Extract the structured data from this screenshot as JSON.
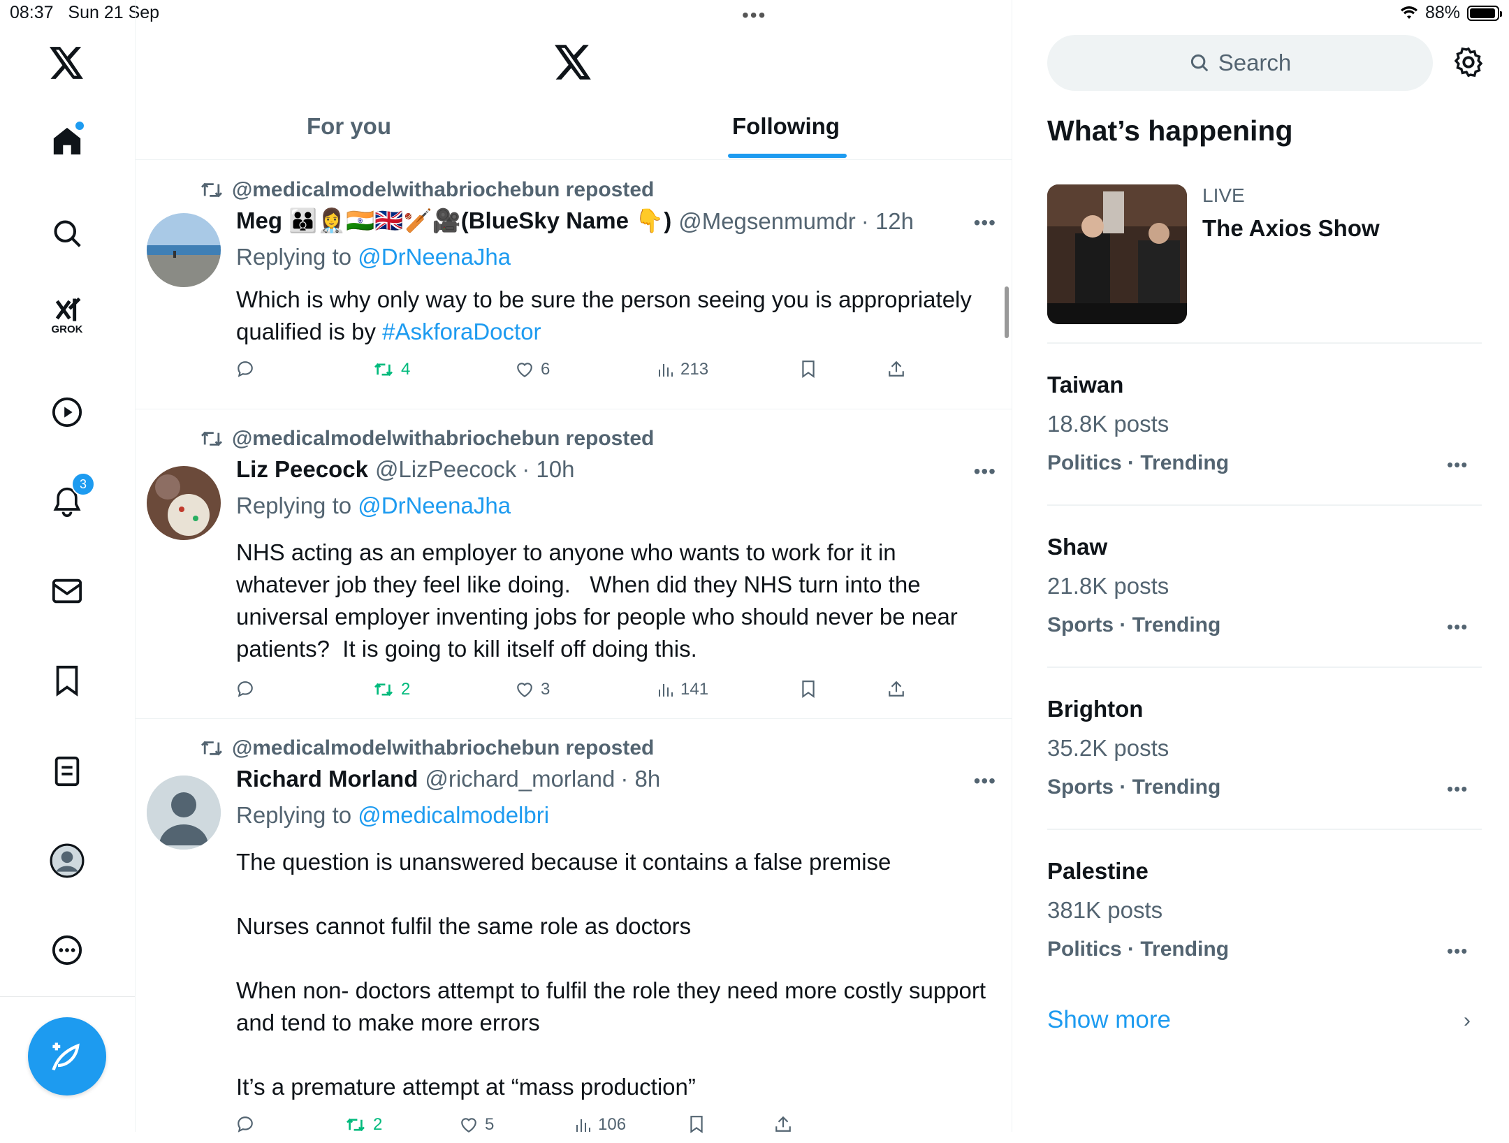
{
  "status": {
    "time": "08:37",
    "date": "Sun 21 Sep",
    "battery": "88%",
    "battery_level": 0.88
  },
  "nav": {
    "items": [
      {
        "name": "home-icon"
      },
      {
        "name": "search-icon"
      },
      {
        "name": "grok-icon",
        "label": "GROK"
      },
      {
        "name": "video-icon"
      },
      {
        "name": "notifications-icon",
        "badge": "3"
      },
      {
        "name": "messages-icon"
      },
      {
        "name": "bookmarks-icon"
      },
      {
        "name": "lists-icon"
      },
      {
        "name": "profile-icon"
      },
      {
        "name": "more-icon"
      }
    ],
    "compose_icon": "compose-icon"
  },
  "tabs": [
    {
      "label": "For you"
    },
    {
      "label": "Following"
    }
  ],
  "posts": [
    {
      "repost_by": "@medicalmodelwithabriochebun reposted",
      "name": "Meg 👪👩‍⚕️🇮🇳🇬🇧🏏🎥(BlueSky Name 👇)",
      "handle": "@Megsenmumdr",
      "time": "· 12h",
      "reply_label": "Replying to",
      "reply_to": "@DrNeenaJha",
      "text": "Which is why only way to be sure the person seeing you is appropriately qualified is by ",
      "hashtag": "#AskforaDoctor",
      "reposts": "4",
      "likes": "6",
      "views": "213"
    },
    {
      "repost_by": "@medicalmodelwithabriochebun reposted",
      "name": "Liz Peecock",
      "handle": "@LizPeecock",
      "time": "· 10h",
      "reply_label": "Replying to",
      "reply_to": "@DrNeenaJha",
      "text": "NHS acting as an employer to anyone who wants to work for it in whatever job they feel like doing.   When did they NHS turn into the universal employer inventing jobs for people who should never be near patients?  It is going to kill itself off doing this.",
      "reposts": "2",
      "likes": "3",
      "views": "141"
    },
    {
      "repost_by": "@medicalmodelwithabriochebun reposted",
      "name": "Richard Morland",
      "handle": "@richard_morland",
      "time": "· 8h",
      "reply_label": "Replying to",
      "reply_to": "@medicalmodelbri",
      "paragraphs": [
        "The question is unanswered because it contains a false premise",
        "Nurses cannot fulfil the same role as doctors",
        "When non- doctors attempt to fulfil the role they need more costly support and tend to make more errors",
        "It’s a premature attempt at “mass production”"
      ],
      "reposts": "2",
      "likes": "5",
      "views": "106"
    }
  ],
  "right": {
    "search_placeholder": "Search",
    "whats_happening": "What’s happening",
    "live": {
      "label": "LIVE",
      "title": "The Axios Show"
    },
    "trends": [
      {
        "name": "Taiwan",
        "count": "18.8K posts",
        "meta": "Politics · Trending"
      },
      {
        "name": "Shaw",
        "count": "21.8K posts",
        "meta": "Sports · Trending"
      },
      {
        "name": "Brighton",
        "count": "35.2K posts",
        "meta": "Sports · Trending"
      },
      {
        "name": "Palestine",
        "count": "381K posts",
        "meta": "Politics · Trending"
      }
    ],
    "show_more": "Show more"
  }
}
